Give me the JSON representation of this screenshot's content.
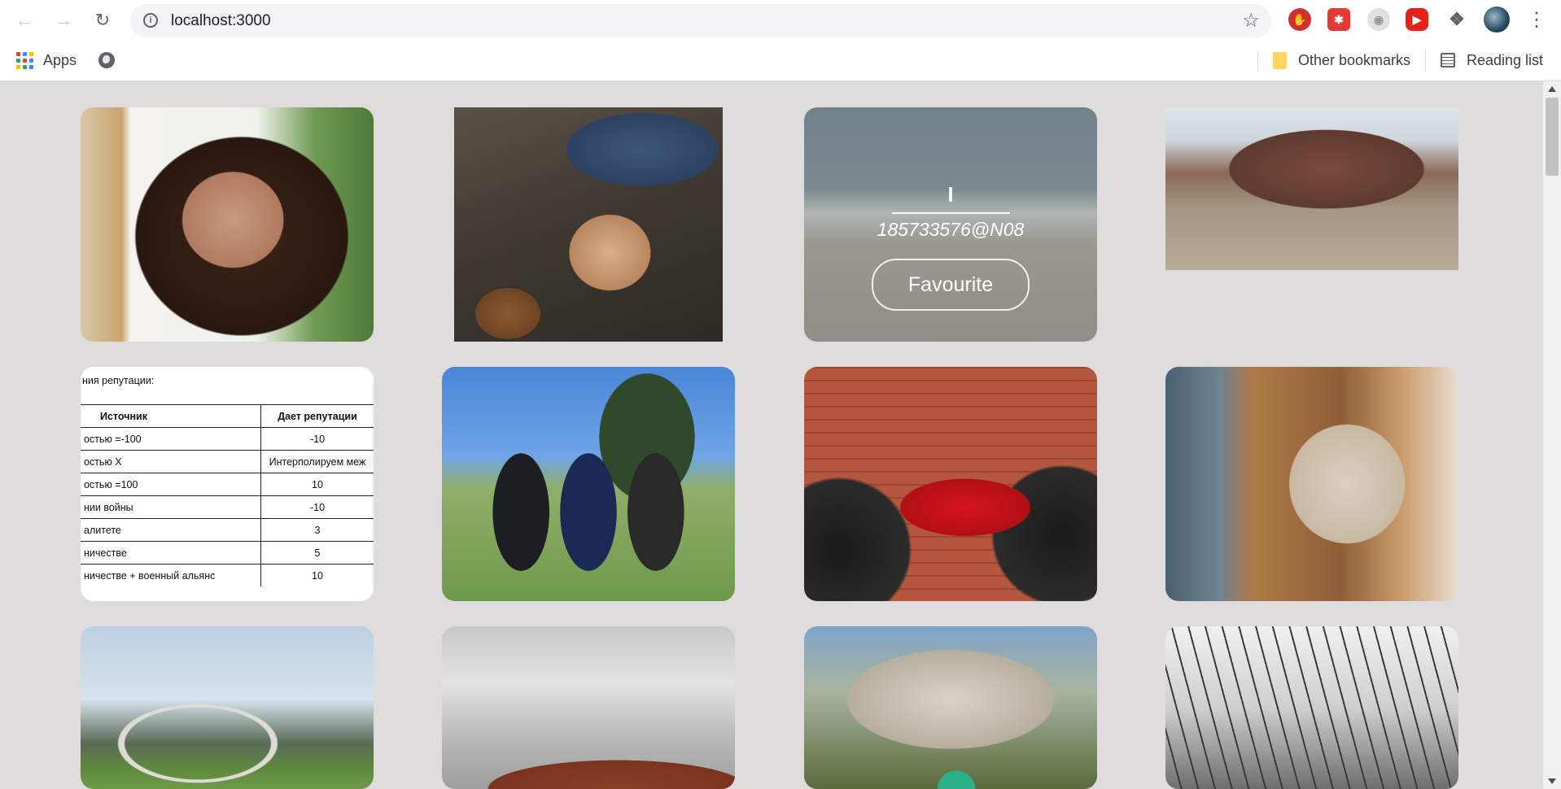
{
  "browser": {
    "url": "localhost:3000",
    "bookmarks": {
      "apps_label": "Apps",
      "other_bookmarks_label": "Other bookmarks",
      "reading_list_label": "Reading list"
    },
    "extensions": [
      "adblock-icon",
      "grid-extension-icon",
      "record-icon",
      "youtube-icon",
      "puzzle-icon"
    ],
    "colors": {
      "toolbar_bg": "#ffffff",
      "omnibox_bg": "#f1f3f4",
      "page_bg": "#dedcdc"
    }
  },
  "gallery": {
    "hovered_card": {
      "title": "I",
      "owner": "185733576@N08",
      "button_label": "Favourite"
    },
    "photos": [
      "portrait-woman",
      "child-with-teddy",
      "beach-legs",
      "desert-campsite",
      "reputation-table",
      "golfers",
      "red-bicycle",
      "dining-interior",
      "arch-bridge-train",
      "cloudy-red-rock",
      "blossom-tree-child",
      "bw-trees"
    ],
    "table_image": {
      "caption": "ния репутации:",
      "headers": [
        "Источник",
        "Дает репутации"
      ],
      "rows": [
        [
          "остью =-100",
          "-10"
        ],
        [
          "остью X",
          "Интерполируем меж"
        ],
        [
          "остью =100",
          "10"
        ],
        [
          "нии войны",
          "-10"
        ],
        [
          "алитете",
          "3"
        ],
        [
          "ничестве",
          "5"
        ],
        [
          "ничестве + военный альянс",
          "10"
        ]
      ]
    }
  }
}
